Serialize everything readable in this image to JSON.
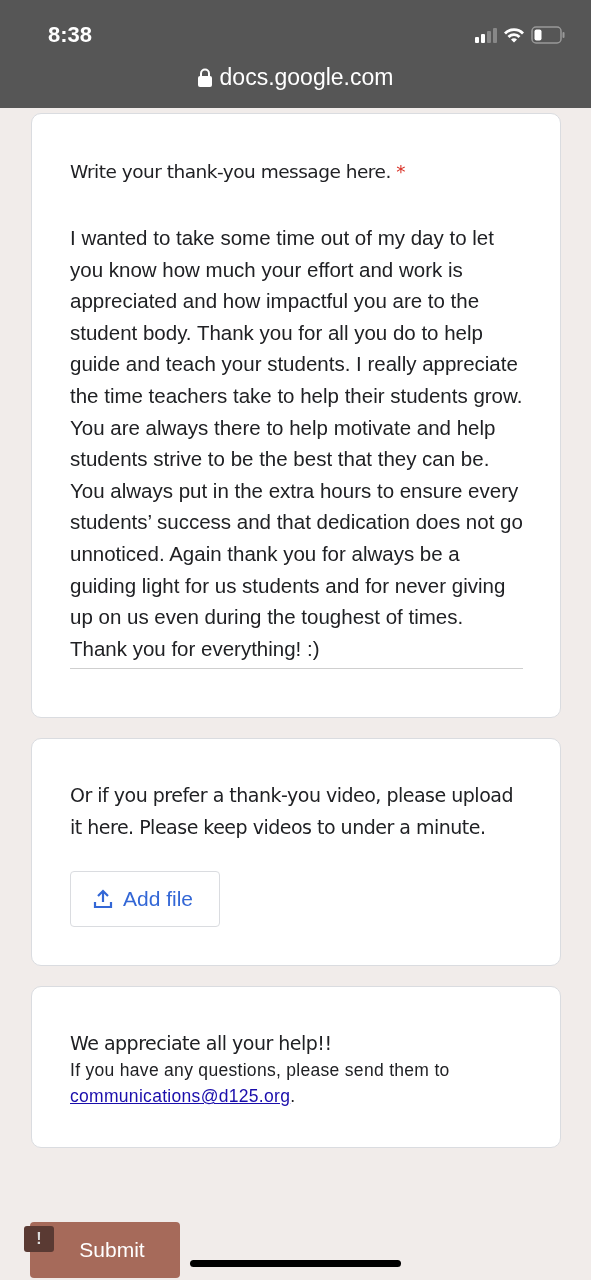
{
  "status_bar": {
    "time": "8:38"
  },
  "address_bar": {
    "url": "docs.google.com"
  },
  "questions": [
    {
      "kind": "paragraph",
      "title": "Write your thank-you message here.",
      "required": true,
      "required_mark": "*",
      "value": "I wanted to take some time out of my day to let you know how much your effort and work is appreciated and how impactful you are to the student body. Thank you for all you do to help guide and teach your students. I really appreciate the time teachers take to help their students grow. You are always there to help motivate and help students strive to be the best that they can be. You always put in the extra hours to ensure every students’ success and that dedication does not go unnoticed. Again thank you for always be a guiding light for us students and for never giving up on us even during the toughest of times. Thank you for everything! :)"
    },
    {
      "kind": "upload",
      "title": "Or if you prefer a thank-you video, please upload it here. Please keep videos to under a minute.",
      "required": false,
      "button": "Add file"
    },
    {
      "kind": "info",
      "title": "We appreciate all your help!!",
      "description": "If you have any questions, please send them to ",
      "link": "communications@d125.org",
      "after_link": "."
    }
  ],
  "submit": "Submit",
  "feedback_mark": "!"
}
